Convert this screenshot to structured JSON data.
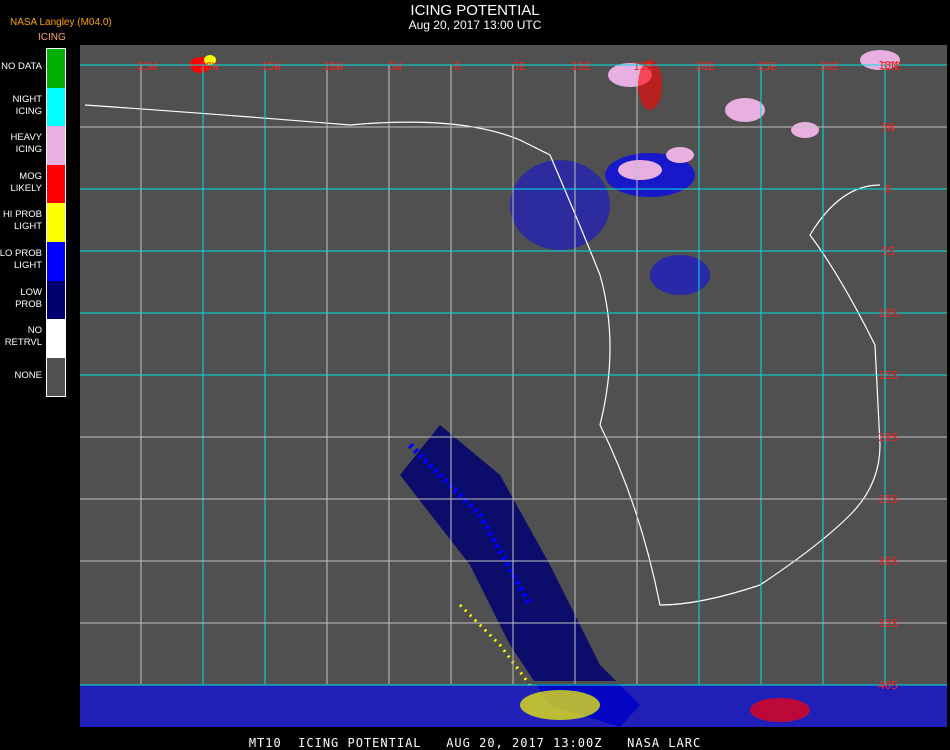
{
  "header": {
    "title": "ICING POTENTIAL",
    "subtitle": "Aug 20, 2017 13:00 UTC",
    "provider": "NASA Langley (M04.0)",
    "legend_title": "ICING"
  },
  "legend": [
    {
      "label": "NO DATA",
      "color": "#00b000"
    },
    {
      "label": "NIGHT\nICING",
      "color": "#00ffff"
    },
    {
      "label": "HEAVY\nICING",
      "color": "#e8b0e0"
    },
    {
      "label": "MOG\nLIKELY",
      "color": "#ff0000"
    },
    {
      "label": "HI PROB\nLIGHT",
      "color": "#ffff00"
    },
    {
      "label": "LO PROB\nLIGHT",
      "color": "#0000ff"
    },
    {
      "label": "LOW\nPROB",
      "color": "#000070"
    },
    {
      "label": "NO\nRETRVL",
      "color": "#ffffff"
    },
    {
      "label": "NONE",
      "color": "#505050"
    }
  ],
  "map": {
    "lon_labels": [
      "25W",
      "20W",
      "15W",
      "10W",
      "5W",
      "0",
      "5E",
      "10E",
      "15E",
      "20E",
      "25E",
      "30E",
      "35E"
    ],
    "lat_labels": [
      "10N",
      "5N",
      "0",
      "5S",
      "10S",
      "15S",
      "20S",
      "25S",
      "30S",
      "35S",
      "40S"
    ]
  },
  "footer": "MT10  ICING POTENTIAL   AUG 20, 2017 13:00Z   NASA LARC"
}
